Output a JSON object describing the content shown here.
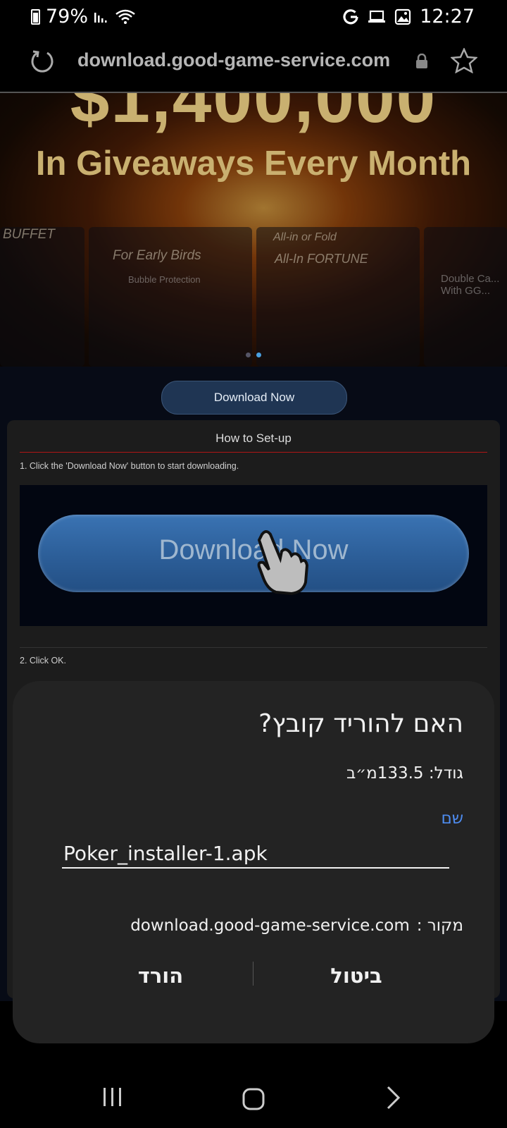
{
  "status_bar": {
    "battery": "79%",
    "time": "12:27"
  },
  "browser": {
    "url": "download.good-game-service.com"
  },
  "hero": {
    "amount_text": "$1,400,000",
    "headline": "In Giveaways Every Month",
    "card_labels": [
      "BUFFET",
      "For Early Birds",
      "Bubble Protection",
      "All-in or Fold",
      "All-In FORTUNE",
      "Double Ca... With GG..."
    ]
  },
  "page": {
    "download_button": "Download Now",
    "setup_title": "How to Set-up",
    "step1": "1. Click the 'Download Now' button to start downloading.",
    "demo_button": "Download Now",
    "step2": "2. Click OK."
  },
  "dialog": {
    "title": "האם להוריד קובץ?",
    "size": "גודל: 133.5מ״ב",
    "name_label": "שם",
    "filename": "Poker_installer-1.apk",
    "source_label": "מקור :",
    "source_value": "download.good-game-service.com",
    "download_label": "הורד",
    "cancel_label": "ביטול"
  },
  "colors": {
    "accent": "#4e8cf0",
    "sheet_bg": "#232323",
    "page_bg": "#070b16"
  }
}
